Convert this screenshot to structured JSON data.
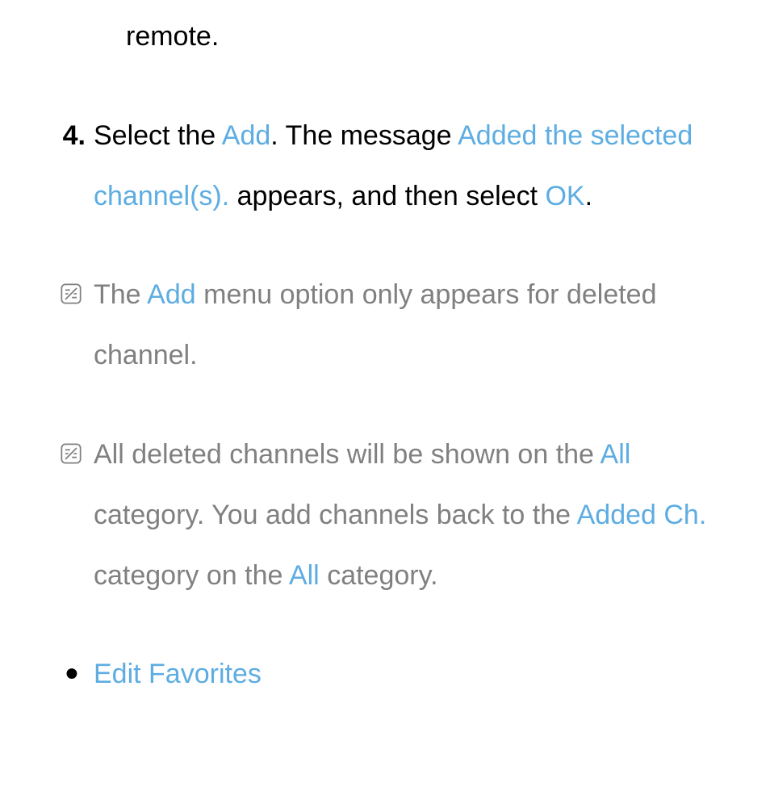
{
  "line_top": "remote.",
  "step4": {
    "marker": "4.",
    "p1": "Select the ",
    "blue1": "Add",
    "p2": ". The message ",
    "blue2": "Added the selected channel(s).",
    "p3": " appears, and then select ",
    "blue3": "OK",
    "p4": "."
  },
  "note1": {
    "p1": "The ",
    "blue1": "Add",
    "p2": " menu option only appears for deleted channel."
  },
  "note2": {
    "p1": "All deleted channels will be shown on the ",
    "blue1": "All",
    "p2": " category. You add channels back to the ",
    "blue2": "Added Ch.",
    "p3": " category on the ",
    "blue3": "All",
    "p4": " category."
  },
  "bullet": {
    "marker": "●",
    "label": "Edit Favorites"
  }
}
